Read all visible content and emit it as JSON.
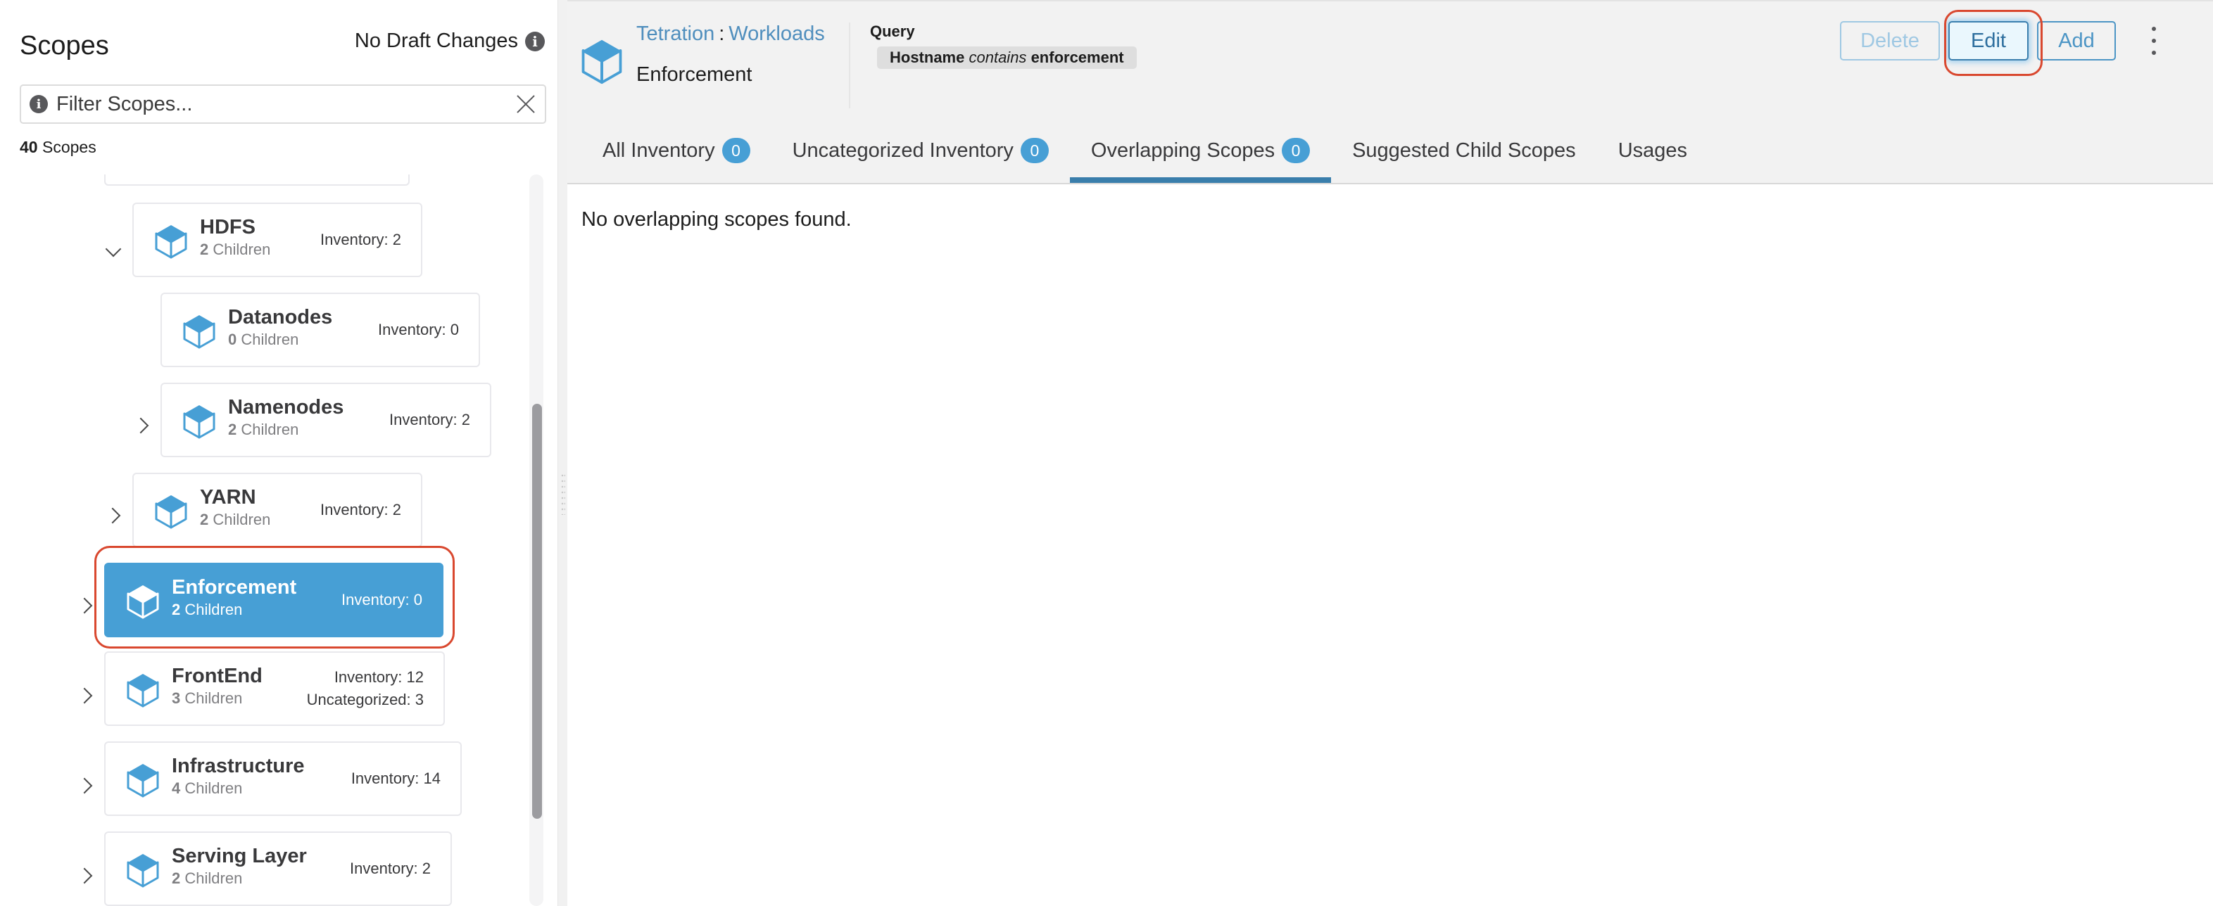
{
  "left_panel": {
    "title": "Scopes",
    "draft_status": "No Draft Changes",
    "filter": {
      "placeholder": "Filter Scopes...",
      "value": ""
    },
    "scope_count": "40",
    "scope_count_label": "Scopes",
    "scopes": [
      {
        "name": "HDFS",
        "children_count": "2",
        "children_label": "Children",
        "inventory": "Inventory: 2",
        "expander": "expanded"
      },
      {
        "name": "Datanodes",
        "children_count": "0",
        "children_label": "Children",
        "inventory": "Inventory: 0",
        "expander": "none"
      },
      {
        "name": "Namenodes",
        "children_count": "2",
        "children_label": "Children",
        "inventory": "Inventory: 2",
        "expander": "collapsed"
      },
      {
        "name": "YARN",
        "children_count": "2",
        "children_label": "Children",
        "inventory": "Inventory: 2",
        "expander": "collapsed"
      },
      {
        "name": "Enforcement",
        "children_count": "2",
        "children_label": "Children",
        "inventory": "Inventory: 0",
        "expander": "collapsed",
        "selected": true
      },
      {
        "name": "FrontEnd",
        "children_count": "3",
        "children_label": "Children",
        "inventory": "Inventory: 12",
        "uncategorized": "Uncategorized: 3",
        "expander": "collapsed"
      },
      {
        "name": "Infrastructure",
        "children_count": "4",
        "children_label": "Children",
        "inventory": "Inventory: 14",
        "expander": "collapsed"
      },
      {
        "name": "Serving Layer",
        "children_count": "2",
        "children_label": "Children",
        "inventory": "Inventory: 2",
        "expander": "collapsed"
      }
    ]
  },
  "header": {
    "breadcrumb_root": "Tetration",
    "breadcrumb_separator": ":",
    "breadcrumb_parent": "Workloads",
    "scope_name": "Enforcement",
    "query_label": "Query",
    "query": {
      "field": "Hostname",
      "operator": "contains",
      "value": "enforcement"
    },
    "buttons": {
      "delete": "Delete",
      "edit": "Edit",
      "add": "Add"
    }
  },
  "tabs": [
    {
      "label": "All Inventory",
      "badge": "0"
    },
    {
      "label": "Uncategorized Inventory",
      "badge": "0"
    },
    {
      "label": "Overlapping Scopes",
      "badge": "0",
      "active": true
    },
    {
      "label": "Suggested Child Scopes"
    },
    {
      "label": "Usages"
    }
  ],
  "content": {
    "message": "No overlapping scopes found."
  },
  "colors": {
    "accent": "#479fd5",
    "link": "#4f8ebd",
    "highlight_ring": "#d9482f",
    "active_tab": "#3a7eab"
  }
}
